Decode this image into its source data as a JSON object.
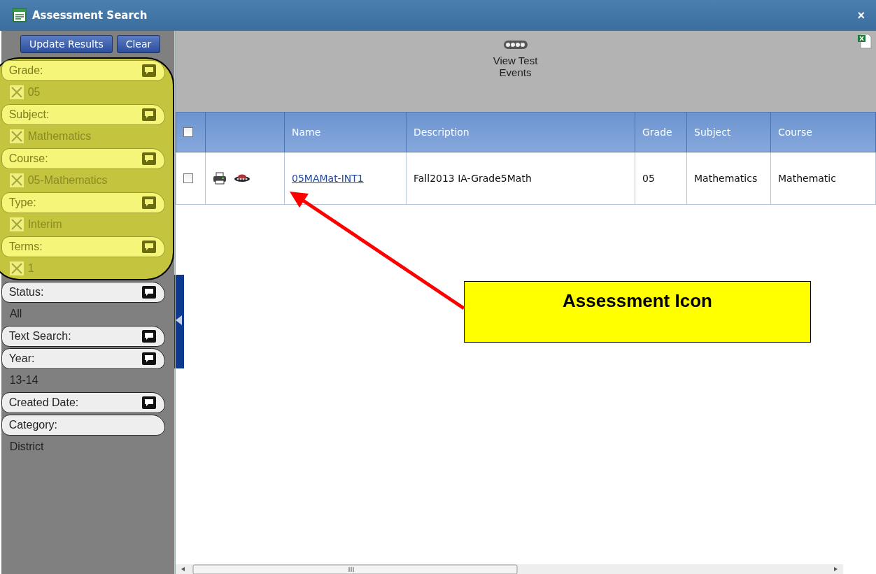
{
  "window": {
    "title": "Assessment Search",
    "close": "×"
  },
  "sidebar": {
    "buttons": [
      "Update Results",
      "Clear"
    ],
    "highlighted_filters": [
      {
        "label": "Grade:",
        "has_note": true,
        "values": [
          {
            "text": "05",
            "removable": true
          }
        ]
      },
      {
        "label": "Subject:",
        "has_note": true,
        "values": [
          {
            "text": "Mathematics",
            "removable": true
          }
        ]
      },
      {
        "label": "Course:",
        "has_note": true,
        "values": [
          {
            "text": "05-Mathematics",
            "removable": true
          }
        ]
      },
      {
        "label": "Type:",
        "has_note": true,
        "values": [
          {
            "text": "Interim",
            "removable": true
          }
        ]
      },
      {
        "label": "Terms:",
        "has_note": true,
        "values": [
          {
            "text": "1",
            "removable": true
          }
        ]
      }
    ],
    "filters": [
      {
        "label": "Status:",
        "has_note": true,
        "values": [
          {
            "text": "All",
            "removable": false
          }
        ]
      },
      {
        "label": "Text Search:",
        "has_note": true
      },
      {
        "label": "Year:",
        "has_note": true,
        "values": [
          {
            "text": "13-14",
            "removable": false
          }
        ]
      },
      {
        "label": "Created Date:",
        "has_note": true
      },
      {
        "label": "Category:",
        "has_note": false,
        "values": [
          {
            "text": "District",
            "removable": false
          }
        ]
      }
    ]
  },
  "toolbar": {
    "action": "View Test Events"
  },
  "table": {
    "header_checked": false,
    "columns": [
      "Name",
      "Description",
      "Grade",
      "Subject",
      "Course"
    ],
    "rows": [
      {
        "checked": false,
        "cells": [
          "05MAMat-INT1",
          "Fall2013 IA-Grade5Math",
          "05",
          "Mathematics",
          "Mathematic"
        ]
      }
    ]
  },
  "callout": {
    "text": "Assessment Icon"
  }
}
